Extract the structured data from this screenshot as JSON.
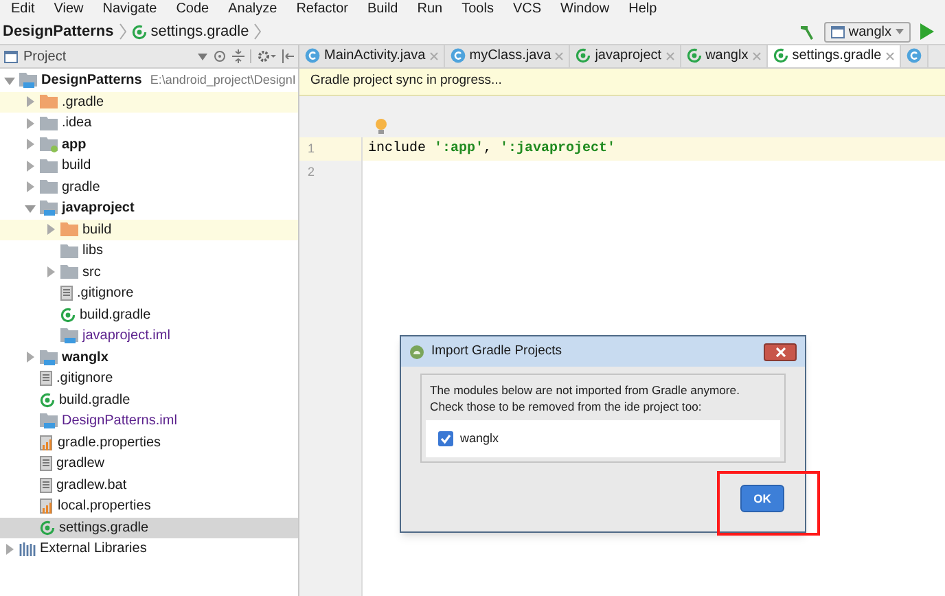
{
  "menu": [
    "Edit",
    "View",
    "Navigate",
    "Code",
    "Analyze",
    "Refactor",
    "Build",
    "Run",
    "Tools",
    "VCS",
    "Window",
    "Help"
  ],
  "breadcrumb": [
    {
      "label": "DesignPatterns",
      "kind": "project"
    },
    {
      "label": "settings.gradle",
      "kind": "gradle"
    }
  ],
  "run_config": {
    "label": "wanglx"
  },
  "project_panel": {
    "title": "Project"
  },
  "tabs": [
    {
      "label": "MainActivity.java",
      "kind": "class",
      "selected": false
    },
    {
      "label": "myClass.java",
      "kind": "class",
      "selected": false
    },
    {
      "label": "javaproject",
      "kind": "gradle",
      "selected": false
    },
    {
      "label": "wanglx",
      "kind": "gradle",
      "selected": false
    },
    {
      "label": "settings.gradle",
      "kind": "gradle",
      "selected": true
    },
    {
      "kind": "class",
      "selected": false
    }
  ],
  "tree": [
    {
      "label": "DesignPatterns",
      "path": "E:\\android_project\\DesignI",
      "kind": "module",
      "bold": true,
      "expanded": true,
      "selected": false,
      "highlighted": false,
      "children": [
        {
          "label": ".gradle",
          "kind": "folder-excluded",
          "expanded": false,
          "selected": false,
          "highlighted": true
        },
        {
          "label": ".idea",
          "kind": "folder",
          "expanded": false,
          "selected": false,
          "highlighted": false
        },
        {
          "label": "app",
          "kind": "android",
          "bold": true,
          "expanded": false,
          "selected": false,
          "highlighted": false
        },
        {
          "label": "build",
          "kind": "folder",
          "expanded": false,
          "selected": false,
          "highlighted": false
        },
        {
          "label": "gradle",
          "kind": "folder",
          "expanded": false,
          "selected": false,
          "highlighted": false
        },
        {
          "label": "javaproject",
          "kind": "module",
          "bold": true,
          "expanded": true,
          "selected": false,
          "highlighted": false,
          "children": [
            {
              "label": "build",
              "kind": "folder-excluded",
              "expanded": false,
              "selected": false,
              "highlighted": true
            },
            {
              "label": "libs",
              "kind": "folder",
              "selected": false,
              "highlighted": false
            },
            {
              "label": "src",
              "kind": "folder",
              "expanded": false,
              "selected": false,
              "highlighted": false
            },
            {
              "label": ".gitignore",
              "kind": "text",
              "selected": false,
              "highlighted": false
            },
            {
              "label": "build.gradle",
              "kind": "gradle",
              "selected": false,
              "highlighted": false
            },
            {
              "label": "javaproject.iml",
              "kind": "iml",
              "selected": false,
              "highlighted": false
            }
          ]
        },
        {
          "label": "wanglx",
          "kind": "module",
          "bold": true,
          "expanded": false,
          "selected": false,
          "highlighted": false
        },
        {
          "label": ".gitignore",
          "kind": "text",
          "selected": false,
          "highlighted": false
        },
        {
          "label": "build.gradle",
          "kind": "gradle",
          "selected": false,
          "highlighted": false
        },
        {
          "label": "DesignPatterns.iml",
          "kind": "iml",
          "selected": false,
          "highlighted": false
        },
        {
          "label": "gradle.properties",
          "kind": "properties",
          "selected": false,
          "highlighted": false
        },
        {
          "label": "gradlew",
          "kind": "text",
          "selected": false,
          "highlighted": false
        },
        {
          "label": "gradlew.bat",
          "kind": "text",
          "selected": false,
          "highlighted": false
        },
        {
          "label": "local.properties",
          "kind": "properties",
          "selected": false,
          "highlighted": false
        },
        {
          "label": "settings.gradle",
          "kind": "gradle",
          "selected": true,
          "highlighted": false
        }
      ]
    },
    {
      "label": "External Libraries",
      "kind": "library",
      "expanded": false,
      "selected": false,
      "highlighted": false
    }
  ],
  "banner": "Gradle project sync in progress...",
  "editor": {
    "lines": [
      {
        "number": "1",
        "current": true,
        "tokens": [
          {
            "text": "include ",
            "kind": "plain"
          },
          {
            "text": "':app'",
            "kind": "string"
          },
          {
            "text": ", ",
            "kind": "plain"
          },
          {
            "text": "':javaproject'",
            "kind": "string"
          }
        ]
      },
      {
        "number": "2",
        "current": false
      }
    ]
  },
  "dialog": {
    "title": "Import Gradle Projects",
    "message": "The modules below are not imported from Gradle anymore.\nCheck those to be removed from the ide project too:",
    "modules": [
      {
        "label": "wanglx",
        "checked": true
      }
    ],
    "ok": "OK"
  }
}
